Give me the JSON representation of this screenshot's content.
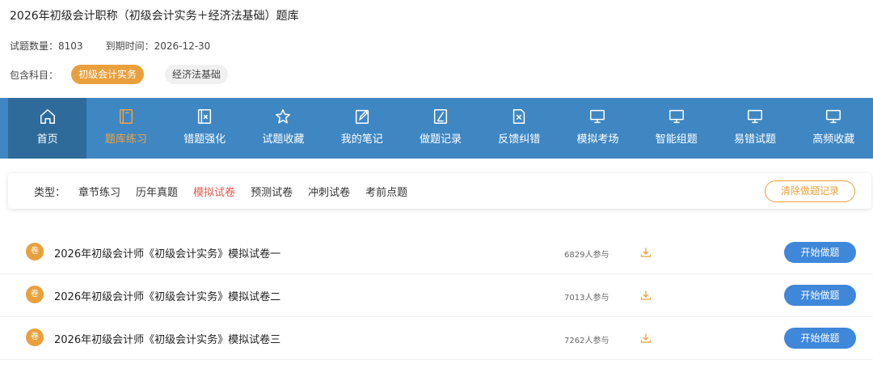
{
  "header": {
    "title": "2026年初级会计职称（初级会计实务＋经济法基础）题库",
    "question_count_label": "试题数量：",
    "question_count": "8103",
    "expiry_label": "到期时间：",
    "expiry_date": "2026-12-30",
    "subjects_label": "包含科目：",
    "subjects": [
      "初级会计实务",
      "经济法基础"
    ]
  },
  "nav": {
    "items": [
      {
        "label": "首页",
        "icon": "home-icon"
      },
      {
        "label": "题库练习",
        "icon": "book-icon"
      },
      {
        "label": "错题强化",
        "icon": "wrong-question-icon"
      },
      {
        "label": "试题收藏",
        "icon": "star-icon"
      },
      {
        "label": "我的笔记",
        "icon": "note-edit-icon"
      },
      {
        "label": "做题记录",
        "icon": "record-icon"
      },
      {
        "label": "反馈纠错",
        "icon": "feedback-icon"
      },
      {
        "label": "模拟考场",
        "icon": "monitor-icon"
      },
      {
        "label": "智能组题",
        "icon": "monitor-icon"
      },
      {
        "label": "易错试题",
        "icon": "monitor-icon"
      },
      {
        "label": "高频收藏",
        "icon": "monitor-icon"
      }
    ],
    "selected": "题库练习"
  },
  "types": {
    "label": "类型：",
    "items": [
      "章节练习",
      "历年真题",
      "模拟试卷",
      "预测试卷",
      "冲刺试卷",
      "考前点题"
    ],
    "selected": "模拟试卷",
    "clear_button": "清除做题记录"
  },
  "papers": [
    {
      "badge": "卷",
      "title": "2026年初级会计师《初级会计实务》模拟试卷一",
      "participants": "6829人参与",
      "button": "开始做题"
    },
    {
      "badge": "卷",
      "title": "2026年初级会计师《初级会计实务》模拟试卷二",
      "participants": "7013人参与",
      "button": "开始做题"
    },
    {
      "badge": "卷",
      "title": "2026年初级会计师《初级会计实务》模拟试卷三",
      "participants": "7262人参与",
      "button": "开始做题"
    }
  ],
  "colors": {
    "nav_bg": "#3f87c3",
    "nav_home_bg": "#2f6b9a",
    "accent_orange": "#e9a03c",
    "active_red": "#e05a4e",
    "button_blue": "#3f87d9"
  }
}
